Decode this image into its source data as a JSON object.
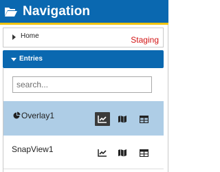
{
  "header": {
    "title": "Navigation",
    "icon": "folder-open-icon"
  },
  "home": {
    "label": "Home",
    "badge": "Staging"
  },
  "entries": {
    "label": "Entries",
    "search_placeholder": "search...",
    "items": [
      {
        "name": "Overlay1",
        "icon": "pie-chart-icon",
        "selected": true
      },
      {
        "name": "SnapView1",
        "selected": false
      }
    ]
  },
  "colors": {
    "primary": "#0a68b0",
    "accent": "#f1c40f",
    "selected_row": "#aecde6",
    "staging": "#d21414"
  }
}
